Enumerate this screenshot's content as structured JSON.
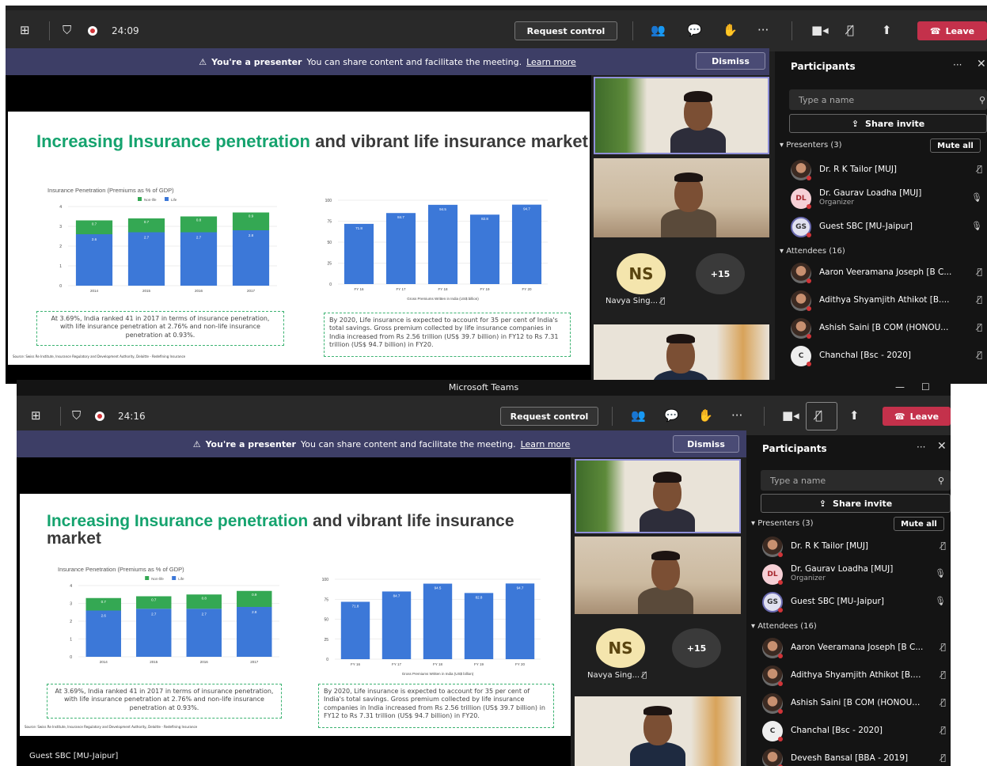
{
  "app_title": "Microsoft Teams",
  "toolbar": {
    "timer_top": "24:09",
    "timer_bottom": "24:16",
    "request_control": "Request control",
    "leave": "Leave",
    "more": "···"
  },
  "banner": {
    "presenter": "You're a presenter",
    "message": "You can share content and facilitate the meeting.",
    "learn_more": "Learn more",
    "dismiss": "Dismiss"
  },
  "slide": {
    "title_green": "Increasing Insurance penetration",
    "title_rest": "and vibrant life insurance market",
    "caption_left": "At 3.69%, India ranked 41 in 2017 in terms of insurance penetration, with life insurance penetration at 2.76% and non-life insurance penetration at 0.93%.",
    "caption_right": "By 2020, Life insurance is expected to account for 35 per cent of India's total savings.  Gross premium collected by life insurance companies in India increased from Rs 2.56 trillion (US$ 39.7 billion) in FY12 to Rs 7.31 trillion (US$ 94.7 billion) in FY20.",
    "source": "Source: Swiss Re Institute, Insurance Regulatory and Development Authority, Deloitte - Redefining Insurance"
  },
  "chart_data": [
    {
      "type": "bar",
      "title": "Insurance Penetration (Premiums as % of GDP)",
      "stacked": true,
      "categories": [
        "2014",
        "2015",
        "2016",
        "2017"
      ],
      "series": [
        {
          "name": "Non-life",
          "values": [
            0.7,
            0.7,
            0.8,
            0.9
          ],
          "color": "#34a853"
        },
        {
          "name": "Life",
          "values": [
            2.6,
            2.7,
            2.7,
            2.8
          ],
          "color": "#3c78d8"
        }
      ],
      "ylim": [
        0,
        4
      ],
      "yticks": [
        "0",
        "1",
        "2",
        "3",
        "4"
      ],
      "legend": "top"
    },
    {
      "type": "bar",
      "xlabel": "Gross Premiums Written in India (US$ billion)",
      "categories": [
        "FY 16",
        "FY 17",
        "FY 18",
        "FY 19",
        "FY 20"
      ],
      "values": [
        71.8,
        84.7,
        94.5,
        82.8,
        94.7
      ],
      "color": "#3c78d8",
      "ylim": [
        0,
        100
      ],
      "yticks": [
        "0",
        "25",
        "50",
        "75",
        "100"
      ]
    }
  ],
  "tiles": {
    "avatar_initials": "NS",
    "avatar_name": "Navya Sing...",
    "overflow": "+15",
    "bottom_label": "Guest SBC [MU-Jaipur]"
  },
  "participants": {
    "title": "Participants",
    "search_placeholder": "Type a name",
    "share_invite": "Share invite",
    "presenters_label": "Presenters (3)",
    "mute_all": "Mute all",
    "attendees_label": "Attendees (16)",
    "presenters": [
      {
        "name": "Dr. R K Tailor [MUJ]",
        "role": "",
        "initials": "",
        "mic": "muted"
      },
      {
        "name": "Dr. Gaurav Loadha [MUJ]",
        "role": "Organizer",
        "initials": "DL",
        "mic": "on"
      },
      {
        "name": "Guest SBC [MU-Jaipur]",
        "role": "",
        "initials": "GS",
        "mic": "on"
      }
    ],
    "attendees_top": [
      {
        "name": "Aaron Veeramana Joseph [B C...",
        "initials": ""
      },
      {
        "name": "Adithya Shyamjith Athikot [B....",
        "initials": ""
      },
      {
        "name": "Ashish Saini [B COM (HONOU...",
        "initials": ""
      },
      {
        "name": "Chanchal [Bsc - 2020]",
        "initials": "C"
      }
    ],
    "attendees_bottom": [
      {
        "name": "Aaron Veeramana Joseph [B C...",
        "initials": ""
      },
      {
        "name": "Adithya Shyamjith Athikot [B....",
        "initials": ""
      },
      {
        "name": "Ashish Saini [B COM (HONOU...",
        "initials": ""
      },
      {
        "name": "Chanchal [Bsc - 2020]",
        "initials": "C"
      },
      {
        "name": "Devesh Bansal [BBA - 2019]",
        "initials": ""
      }
    ]
  },
  "colors": {
    "teams_bg": "#1f1f1f",
    "toolbar": "#292929",
    "banner": "#3d3e66",
    "leave": "#c4314b",
    "slide_green": "#15a36e",
    "bar_blue": "#3c78d8",
    "bar_green": "#34a853"
  }
}
